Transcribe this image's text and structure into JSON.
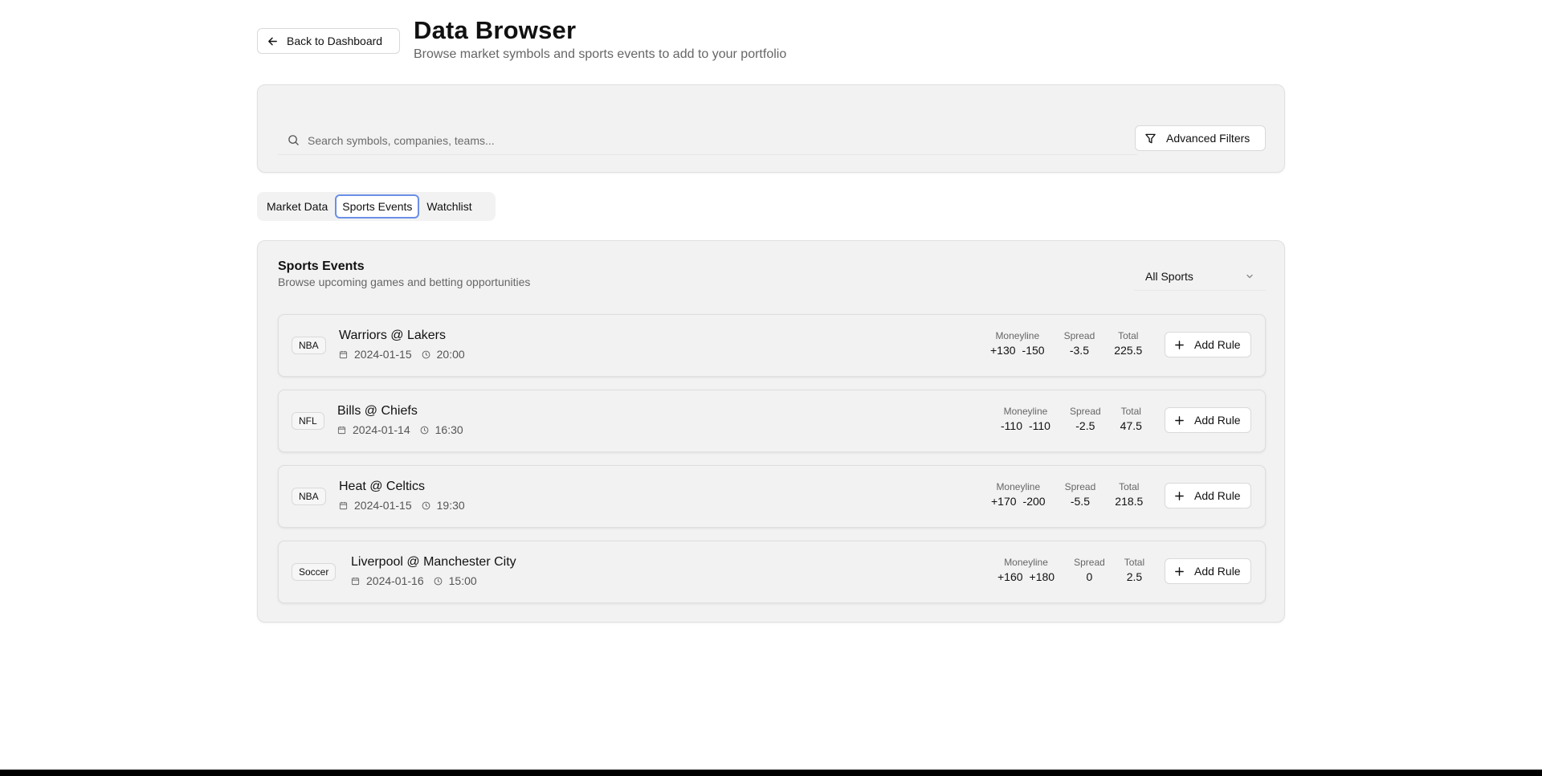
{
  "header": {
    "back_label": "Back to Dashboard",
    "title": "Data Browser",
    "subtitle": "Browse market symbols and sports events to add to your portfolio"
  },
  "search": {
    "placeholder": "Search symbols, companies, teams...",
    "value": "",
    "filters_label": "Advanced Filters"
  },
  "tabs": [
    {
      "label": "Market Data",
      "active": false
    },
    {
      "label": "Sports Events",
      "active": true
    },
    {
      "label": "Watchlist",
      "active": false
    }
  ],
  "events_section": {
    "title": "Sports Events",
    "subtitle": "Browse upcoming games and betting opportunities",
    "sport_filter": "All Sports",
    "moneyline_label": "Moneyline",
    "spread_label": "Spread",
    "total_label": "Total",
    "add_label": "Add Rule"
  },
  "events": [
    {
      "league": "NBA",
      "matchup": "Warriors @ Lakers",
      "date": "2024-01-15",
      "time": "20:00",
      "ml_away": "+130",
      "ml_home": "-150",
      "spread": "-3.5",
      "total": "225.5"
    },
    {
      "league": "NFL",
      "matchup": "Bills @ Chiefs",
      "date": "2024-01-14",
      "time": "16:30",
      "ml_away": "-110",
      "ml_home": "-110",
      "spread": "-2.5",
      "total": "47.5"
    },
    {
      "league": "NBA",
      "matchup": "Heat @ Celtics",
      "date": "2024-01-15",
      "time": "19:30",
      "ml_away": "+170",
      "ml_home": "-200",
      "spread": "-5.5",
      "total": "218.5"
    },
    {
      "league": "Soccer",
      "matchup": "Liverpool @ Manchester City",
      "date": "2024-01-16",
      "time": "15:00",
      "ml_away": "+160",
      "ml_home": "+180",
      "spread": "0",
      "total": "2.5"
    }
  ],
  "colors": {
    "accent": "#6b8fe8",
    "panel_bg": "#f2f2f2",
    "border": "#d9d9d9"
  },
  "icons": [
    "arrow-left-icon",
    "search-icon",
    "filter-icon",
    "chevron-down-icon",
    "calendar-icon",
    "clock-icon",
    "plus-icon"
  ]
}
